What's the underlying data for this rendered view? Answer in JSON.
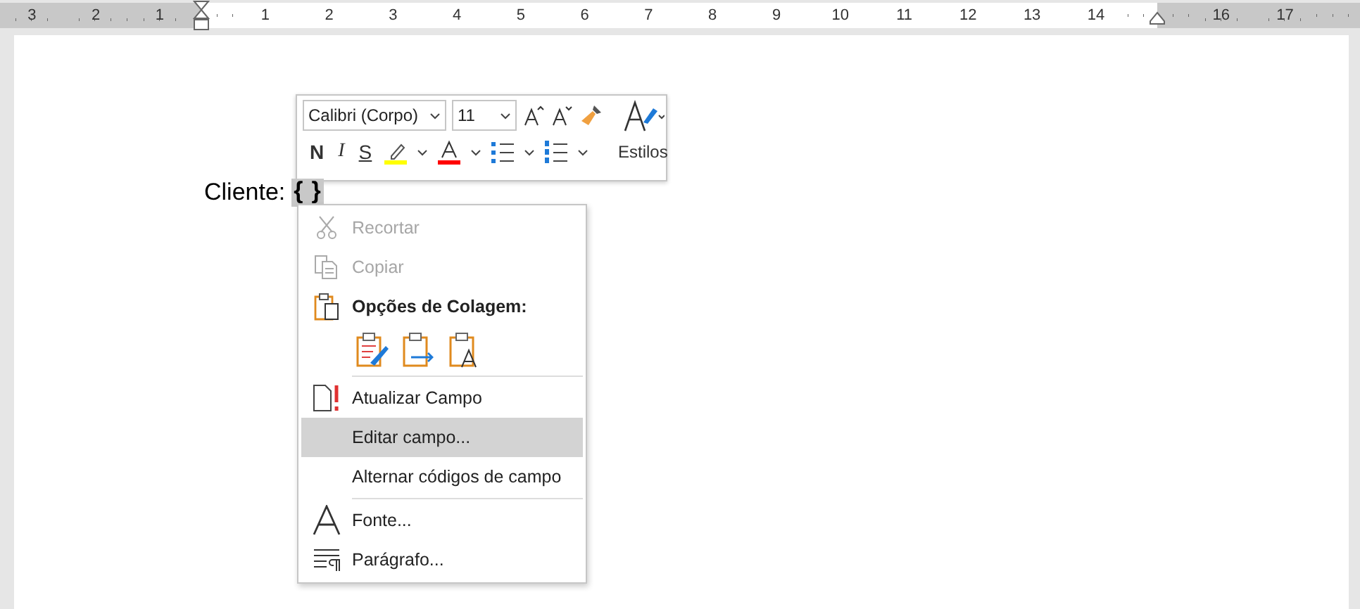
{
  "ruler": {
    "left_margin_labels": [
      "3",
      "2",
      "1"
    ],
    "body_labels": [
      "1",
      "2",
      "3",
      "4",
      "5",
      "6",
      "7",
      "8",
      "9",
      "10",
      "11",
      "12",
      "13",
      "14"
    ],
    "right_margin_labels": [
      "16",
      "17"
    ]
  },
  "document": {
    "label": "Cliente:",
    "field_open": "{",
    "field_close": "}"
  },
  "mini_toolbar": {
    "font": "Calibri (Corpo)",
    "size": "11",
    "format_buttons": [
      "N",
      "I",
      "S"
    ],
    "styles_label": "Estilos"
  },
  "context_menu": [
    {
      "kind": "cut",
      "label": "Recortar",
      "disabled": true,
      "selected": false
    },
    {
      "kind": "copy",
      "label": "Copiar",
      "disabled": true,
      "selected": false
    },
    {
      "kind": "heading",
      "label": "Opções de Colagem:"
    },
    {
      "kind": "paste_options"
    },
    {
      "kind": "separator"
    },
    {
      "kind": "update",
      "label": "Atualizar Campo",
      "disabled": false,
      "selected": false
    },
    {
      "kind": "plain",
      "label": "Editar campo...",
      "disabled": false,
      "selected": true
    },
    {
      "kind": "plain",
      "label": "Alternar códigos de campo",
      "disabled": false,
      "selected": false
    },
    {
      "kind": "separator"
    },
    {
      "kind": "font",
      "label": "Fonte...",
      "disabled": false,
      "selected": false
    },
    {
      "kind": "paragraph",
      "label": "Parágrafo...",
      "disabled": false,
      "selected": false
    }
  ]
}
